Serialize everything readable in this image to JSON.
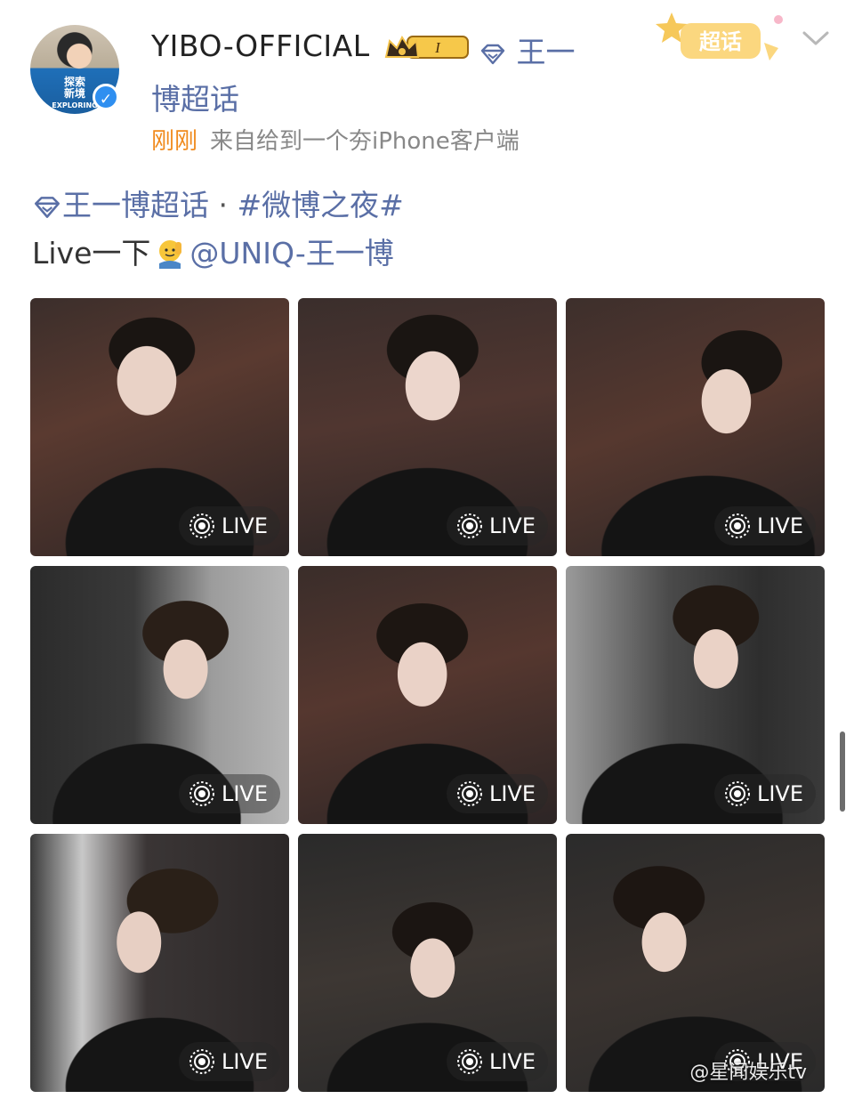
{
  "header": {
    "username": "YIBO-OFFICIAL",
    "level_badge": "I",
    "supertopic_line1": "王一",
    "supertopic_line2": "博超话",
    "time": "刚刚",
    "source": "来自给到一个夯iPhone客户端",
    "supertopic_badge": "超话"
  },
  "avatar": {
    "text_line1": "探索",
    "text_line2": "新境",
    "text_line3": "EXPLORING"
  },
  "post": {
    "topic": "王一博超话",
    "separator": "·",
    "hashtag": "#微博之夜#",
    "text_prefix": "Live一下",
    "mention": "@UNIQ-王一博"
  },
  "tiles": [
    {
      "label": "LIVE"
    },
    {
      "label": "LIVE"
    },
    {
      "label": "LIVE"
    },
    {
      "label": "LIVE"
    },
    {
      "label": "LIVE"
    },
    {
      "label": "LIVE"
    },
    {
      "label": "LIVE"
    },
    {
      "label": "LIVE"
    },
    {
      "label": "LIVE"
    }
  ],
  "watermark": "@星闻娱乐tv",
  "colors": {
    "link": "#5a6fa6",
    "time": "#f08a1c",
    "verified": "#2f8ff0"
  }
}
